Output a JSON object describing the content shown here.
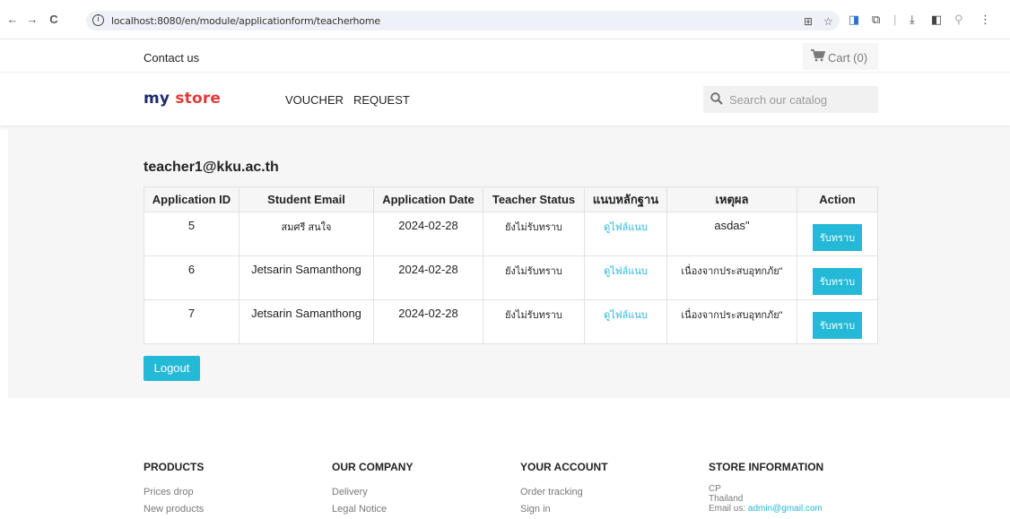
{
  "browser": {
    "url": "localhost:8080/en/module/applicationform/teacherhome",
    "back_icon": "←",
    "forward_icon": "→",
    "reload_icon": "C",
    "info_icon": "i"
  },
  "top_nav": {
    "contact": "Contact us",
    "cart_label": "Cart (0)"
  },
  "header": {
    "logo_part1": "my",
    "logo_part2": "store",
    "menu": [
      "VOUCHER",
      "REQUEST"
    ],
    "search_placeholder": "Search our catalog"
  },
  "main": {
    "user_email": "teacher1@kku.ac.th",
    "table": {
      "headers": [
        "Application ID",
        "Student Email",
        "Application Date",
        "Teacher Status",
        "แนบหลักฐาน",
        "เหตุผล",
        "Action"
      ],
      "rows": [
        {
          "id": "5",
          "student": "สมศรี สนใจ",
          "date": "2024-02-28",
          "status": "ยังไม่รับทราบ",
          "evidence": "ดูไฟล์แนบ",
          "reason": "asdas\"",
          "action": "รับทราบ"
        },
        {
          "id": "6",
          "student": "Jetsarin Samanthong",
          "date": "2024-02-28",
          "status": "ยังไม่รับทราบ",
          "evidence": "ดูไฟล์แนบ",
          "reason": "เนื่องจากประสบอุทกภัย\"",
          "action": "รับทราบ"
        },
        {
          "id": "7",
          "student": "Jetsarin Samanthong",
          "date": "2024-02-28",
          "status": "ยังไม่รับทราบ",
          "evidence": "ดูไฟล์แนบ",
          "reason": "เนื่องจากประสบอุทกภัย\"",
          "action": "รับทราบ"
        }
      ]
    },
    "logout": "Logout"
  },
  "footer": {
    "products": {
      "title": "PRODUCTS",
      "links": [
        "Prices drop",
        "New products"
      ]
    },
    "company": {
      "title": "OUR COMPANY",
      "links": [
        "Delivery",
        "Legal Notice"
      ]
    },
    "account": {
      "title": "YOUR ACCOUNT",
      "links": [
        "Order tracking",
        "Sign in"
      ]
    },
    "store": {
      "title": "STORE INFORMATION",
      "name": "CP",
      "country": "Thailand",
      "email_label": "Email us: ",
      "email": "admin@gmail.com"
    }
  },
  "colors": {
    "accent": "#24b9d7",
    "logo_dark": "#1f2a6b",
    "logo_red": "#e03a3a"
  }
}
